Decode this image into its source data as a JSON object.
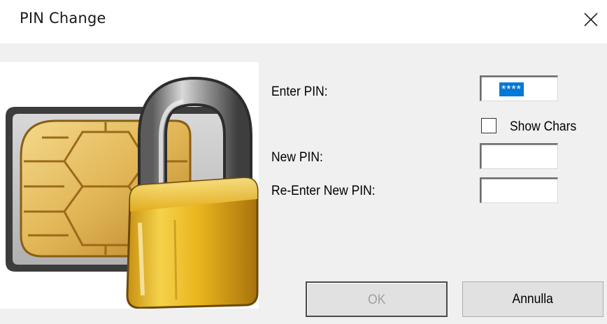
{
  "window": {
    "title": "PIN Change",
    "close_icon": "close-icon"
  },
  "illustration": {
    "icon": "sim-card-padlock-icon"
  },
  "form": {
    "enter_pin_label": "Enter PIN:",
    "enter_pin_value": "****",
    "show_chars_label": "Show Chars",
    "show_chars_checked": false,
    "new_pin_label": "New PIN:",
    "new_pin_value": "",
    "reenter_pin_label": "Re-Enter New PIN:",
    "reenter_pin_value": ""
  },
  "buttons": {
    "ok_label": "OK",
    "ok_enabled": false,
    "cancel_label": "Annulla"
  },
  "colors": {
    "selection": "#0078d7",
    "dialog_bg": "#f0f0f0",
    "lock_gold": "#e6b422",
    "chip_gold": "#e9c26a"
  }
}
